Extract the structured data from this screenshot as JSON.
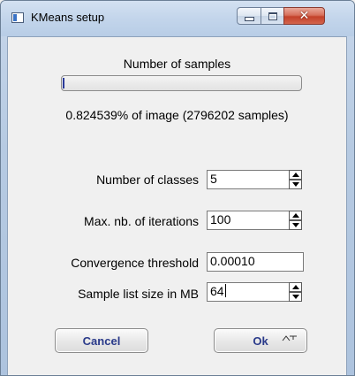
{
  "window": {
    "title": "KMeans setup",
    "controls": {
      "close_glyph": "✕"
    }
  },
  "samples": {
    "heading": "Number of samples",
    "progress_fraction": 0.008,
    "info": "0.824539% of image (2796202 samples)"
  },
  "fields": [
    {
      "label": "Number of classes",
      "value": "5",
      "spinner": true
    },
    {
      "label": "Max. nb.  of iterations",
      "value": "100",
      "spinner": true
    },
    {
      "label": "Convergence threshold",
      "value": "0.00010",
      "spinner": false
    },
    {
      "label": "Sample list size in MB",
      "value": "64",
      "spinner": true
    }
  ],
  "buttons": {
    "cancel": "Cancel",
    "ok": "Ok"
  },
  "colors": {
    "button_text": "#2a3a8a",
    "progress_fill": "#2a3a9a",
    "close_button": "#c4412a"
  },
  "icons": [
    "app-icon",
    "minimize-icon",
    "maximize-icon",
    "close-icon",
    "spin-up-icon",
    "spin-down-icon",
    "resize-grip-icon"
  ]
}
